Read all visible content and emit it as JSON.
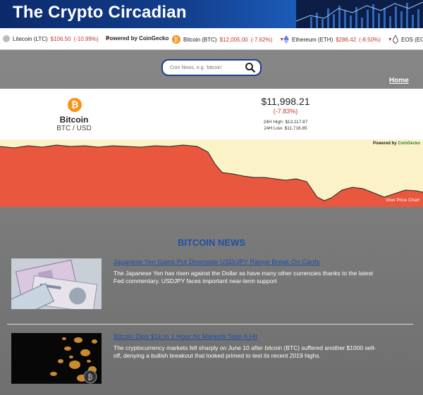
{
  "header": {
    "title": "The Crypto Circadian"
  },
  "ticker": {
    "items": [
      {
        "name": "Litecoin (LTC)",
        "price": "$106.50",
        "change": "(-10.99%)",
        "icon": "litecoin-icon",
        "color": "#bfbbbb"
      },
      {
        "name": "Powered by CoinGecko"
      },
      {
        "name": "Bitcoin (BTC)",
        "price": "$12,005.00",
        "change": "(-7.62%)",
        "icon": "bitcoin-icon",
        "color": "#f7931a"
      },
      {
        "name": "Ethereum (ETH)",
        "price": "$286.42",
        "change": "(-8.50%)",
        "icon": "ethereum-icon",
        "color": "#627eea"
      },
      {
        "name": "EOS (EOS)",
        "icon": "eos-icon",
        "color": "#000000"
      }
    ]
  },
  "search": {
    "placeholder": "Coin News, e.g. 'bitcoin'"
  },
  "nav": {
    "home_label": "Home"
  },
  "price_panel": {
    "coin_name": "Bitcoin",
    "pair": "BTC / USD",
    "price": "$11,998.21",
    "change": "(-7.83%)",
    "high": "24H High: $13,117.87",
    "low": "24H Low: $11,716.85"
  },
  "chart": {
    "powered_prefix": "Powered by ",
    "powered_brand": "CoinGecko",
    "view_label": "View Price Chart",
    "fill_color": "#e9573f",
    "background_color": "#fbf3c7"
  },
  "news": {
    "heading": "BITCOIN NEWS",
    "articles": [
      {
        "title": "Japanese Yen Gains Put Downside USD/JPY Range Break On Cards",
        "description": "The Japanese Yen has risen against the Dollar as have many other currencies thanks to the latest Fed commentary. USDJPY faces important near-term support"
      },
      {
        "title": "Bitcoin Dips $1k In 1 Hour As Markets Take A Hit",
        "description": "The cryptocurrency markets fell sharply on June 10 after bitcoin (BTC) suffered another $1000 sell-off, denying a bullish breakout that looked primed to test its recent 2019 highs."
      }
    ]
  }
}
